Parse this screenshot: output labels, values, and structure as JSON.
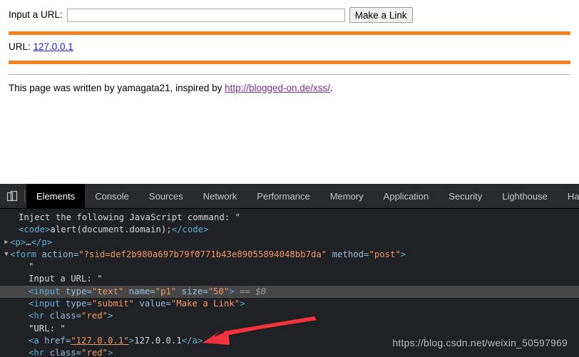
{
  "page": {
    "form": {
      "label": "Input a URL:",
      "input_value": "",
      "input_placeholder": "",
      "submit_label": "Make a Link"
    },
    "result": {
      "prefix": "URL: ",
      "link_text": "127.0.0.1"
    },
    "credit": {
      "before": "This page was written by yamagata21, inspired by ",
      "link_text": "http://blogged-on.de/xss/",
      "after": "."
    },
    "colors": {
      "hr_red": "#f28020",
      "hr_plain": "#b7b7b7",
      "link_blue": "#1a1ae6",
      "link_visited": "#7b2d8e"
    }
  },
  "devtools": {
    "device_toggle_icon": "device-toolbar-icon",
    "tabs": [
      {
        "label": "Elements",
        "active": true
      },
      {
        "label": "Console",
        "active": false
      },
      {
        "label": "Sources",
        "active": false
      },
      {
        "label": "Network",
        "active": false
      },
      {
        "label": "Performance",
        "active": false
      },
      {
        "label": "Memory",
        "active": false
      },
      {
        "label": "Application",
        "active": false
      },
      {
        "label": "Security",
        "active": false
      },
      {
        "label": "Lighthouse",
        "active": false
      },
      {
        "label": "Hac",
        "active": false
      }
    ],
    "colors": {
      "background": "#202124",
      "tabbar": "#292a2d",
      "selected_row": "#474747",
      "tag": "#5db0d7",
      "attr": "#9bbbdc",
      "value": "#f29766",
      "text": "#d5d5d5"
    },
    "dom_lines": [
      {
        "id": "line-inject-text",
        "twisty": "",
        "indent": 1,
        "segments": [
          {
            "cls": "txt",
            "text": "Inject the following JavaScript command: \""
          }
        ]
      },
      {
        "id": "line-code-alert",
        "twisty": "",
        "indent": 1,
        "segments": [
          {
            "cls": "tag",
            "text": "<code>"
          },
          {
            "cls": "txt",
            "text": "alert(document.domain);"
          },
          {
            "cls": "tag",
            "text": "</code>"
          }
        ]
      },
      {
        "id": "line-p-collapsed",
        "twisty": "collapsed",
        "indent": 0,
        "segments": [
          {
            "cls": "tag",
            "text": "<p>"
          },
          {
            "cls": "txt",
            "text": "…"
          },
          {
            "cls": "tag",
            "text": "</p>"
          }
        ]
      },
      {
        "id": "line-form-open",
        "twisty": "expanded",
        "indent": 0,
        "segments": [
          {
            "cls": "tag",
            "text": "<form "
          },
          {
            "cls": "attr",
            "text": "action="
          },
          {
            "cls": "val",
            "text": "\"?sid=def2b980a697b79f0771b43e89055894048bb7da\""
          },
          {
            "cls": "attr",
            "text": " method="
          },
          {
            "cls": "val",
            "text": "\"post\""
          },
          {
            "cls": "tag",
            "text": ">"
          }
        ]
      },
      {
        "id": "line-quote",
        "twisty": "",
        "indent": 2,
        "segments": [
          {
            "cls": "txt",
            "text": "\""
          }
        ]
      },
      {
        "id": "line-input-a-url-text",
        "twisty": "",
        "indent": 2,
        "segments": [
          {
            "cls": "txt",
            "text": "Input a URL: \""
          }
        ]
      },
      {
        "id": "line-input-text-selected",
        "twisty": "",
        "indent": 2,
        "selected": true,
        "segments": [
          {
            "cls": "tag",
            "text": "<input "
          },
          {
            "cls": "attr",
            "text": "type="
          },
          {
            "cls": "val",
            "text": "\"text\""
          },
          {
            "cls": "attr",
            "text": " name="
          },
          {
            "cls": "val",
            "text": "\"p1\""
          },
          {
            "cls": "attr",
            "text": " size="
          },
          {
            "cls": "val",
            "text": "\"50\""
          },
          {
            "cls": "tag",
            "text": ">"
          },
          {
            "cls": "sel-id",
            "text": " == $0"
          }
        ]
      },
      {
        "id": "line-input-submit",
        "twisty": "",
        "indent": 2,
        "segments": [
          {
            "cls": "tag",
            "text": "<input "
          },
          {
            "cls": "attr",
            "text": "type="
          },
          {
            "cls": "val",
            "text": "\"submit\""
          },
          {
            "cls": "attr",
            "text": " value="
          },
          {
            "cls": "val",
            "text": "\"Make a Link\""
          },
          {
            "cls": "tag",
            "text": ">"
          }
        ]
      },
      {
        "id": "line-hr-red-1",
        "twisty": "",
        "indent": 2,
        "segments": [
          {
            "cls": "tag",
            "text": "<hr "
          },
          {
            "cls": "attr",
            "text": "class="
          },
          {
            "cls": "val",
            "text": "\"red\""
          },
          {
            "cls": "tag",
            "text": ">"
          }
        ]
      },
      {
        "id": "line-url-text",
        "twisty": "",
        "indent": 2,
        "segments": [
          {
            "cls": "txt",
            "text": "\"URL: \""
          }
        ]
      },
      {
        "id": "line-anchor",
        "twisty": "",
        "indent": 2,
        "segments": [
          {
            "cls": "tag",
            "text": "<a "
          },
          {
            "cls": "attr",
            "text": "href="
          },
          {
            "cls": "val uline",
            "text": "\"127.0.0.1\""
          },
          {
            "cls": "tag",
            "text": ">"
          },
          {
            "cls": "txt",
            "text": "127.0.0.1"
          },
          {
            "cls": "tag",
            "text": "</a>"
          }
        ]
      },
      {
        "id": "line-hr-red-2",
        "twisty": "",
        "indent": 2,
        "segments": [
          {
            "cls": "tag",
            "text": "<hr "
          },
          {
            "cls": "attr",
            "text": "class="
          },
          {
            "cls": "val",
            "text": "\"red\""
          },
          {
            "cls": "tag",
            "text": ">"
          }
        ]
      }
    ],
    "annotation": {
      "arrow_color": "#f5333f",
      "arrow_name": "red-arrow-annotation"
    },
    "watermark": "https://blog.csdn.net/weixin_50597969"
  }
}
